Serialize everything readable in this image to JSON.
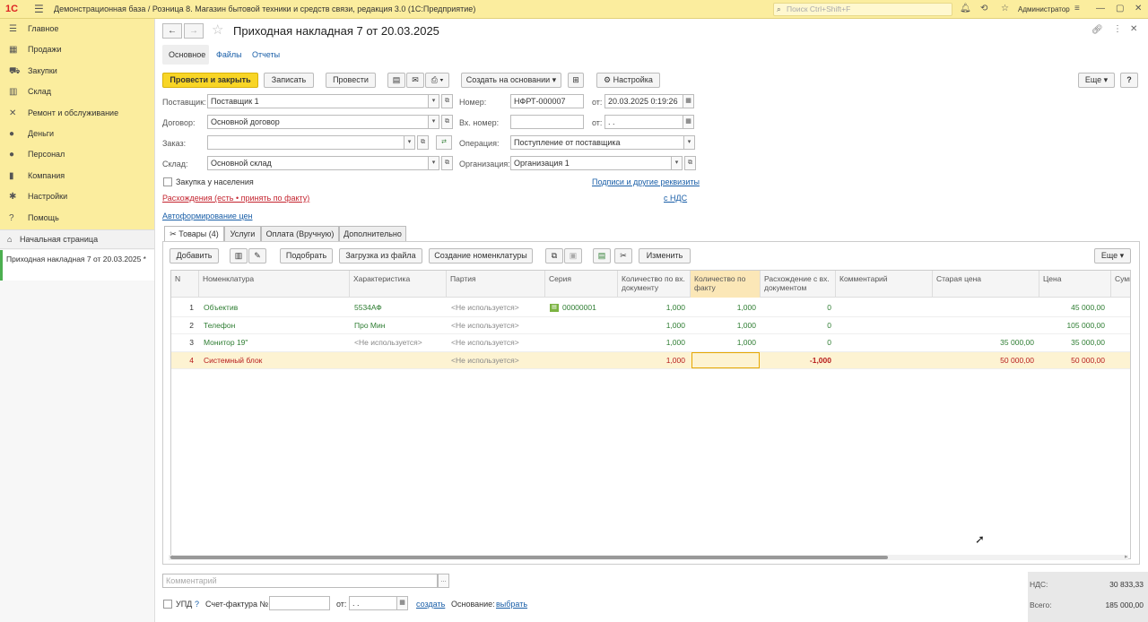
{
  "app": {
    "logo": "1С",
    "title": "Демонстрационная база / Розница 8. Магазин бытовой техники и средств связи, редакция 3.0  (1С:Предприятие)",
    "search_placeholder": "Поиск Ctrl+Shift+F",
    "user": "Администратор"
  },
  "sidebar": {
    "items": [
      {
        "label": "Главное",
        "icon": "menu-icon"
      },
      {
        "label": "Продажи",
        "icon": "cash-register-icon"
      },
      {
        "label": "Закупки",
        "icon": "truck-icon"
      },
      {
        "label": "Склад",
        "icon": "warehouse-icon"
      },
      {
        "label": "Ремонт и обслуживание",
        "icon": "wrench-icon"
      },
      {
        "label": "Деньги",
        "icon": "coin-icon"
      },
      {
        "label": "Персонал",
        "icon": "person-icon"
      },
      {
        "label": "Компания",
        "icon": "building-icon"
      },
      {
        "label": "Настройки",
        "icon": "gear-icon"
      },
      {
        "label": "Помощь",
        "icon": "help-icon"
      }
    ],
    "home": "Начальная страница",
    "open_doc": "Приходная накладная 7 от 20.03.2025 *"
  },
  "doc": {
    "title": "Приходная накладная 7 от 20.03.2025",
    "tabs": [
      "Основное",
      "Файлы",
      "Отчеты"
    ],
    "toolbar": {
      "post_close": "Провести и закрыть",
      "save": "Записать",
      "post": "Провести",
      "create_based": "Создать на основании",
      "settings": "Настройка",
      "more": "Еще"
    },
    "fields": {
      "supplier_label": "Поставщик:",
      "supplier": "Поставщик 1",
      "contract_label": "Договор:",
      "contract": "Основной договор",
      "order_label": "Заказ:",
      "order": "",
      "warehouse_label": "Склад:",
      "warehouse": "Основной склад",
      "number_label": "Номер:",
      "number": "НФРТ-000007",
      "from_label": "от:",
      "date": "20.03.2025  0:19:26",
      "in_number_label": "Вх. номер:",
      "in_number": "",
      "in_date": " .  .",
      "operation_label": "Операция:",
      "operation": "Поступление от поставщика",
      "org_label": "Организация:",
      "org": "Организация 1",
      "population_label": "Закупка у населения",
      "discrepancy_link": "Расхождения (есть • принять по факту)",
      "auto_prices_link": "Автоформирование цен",
      "signatures_link": "Подписи и другие реквизиты",
      "vat_link": "с НДС"
    },
    "inner_tabs": [
      "Товары (4)",
      "Услуги",
      "Оплата (Вручную)",
      "Дополнительно"
    ],
    "grid_toolbar": {
      "add": "Добавить",
      "pick": "Подобрать",
      "load": "Загрузка из файла",
      "create_nom": "Создание номенклатуры",
      "change": "Изменить",
      "more": "Еще"
    },
    "columns": [
      "N",
      "Номенклатура",
      "Характеристика",
      "Партия",
      "Серия",
      "Количество по вх. документу",
      "Количество по факту",
      "Расхождение с вх. документом",
      "Комментарий",
      "Старая цена",
      "Цена",
      "Сумма"
    ],
    "rows": [
      {
        "n": "1",
        "nom": "Объектив",
        "char": "5534АФ",
        "batch": "<Не используется>",
        "series": "00000001",
        "qty_doc": "1,000",
        "qty_fact": "1,000",
        "diff": "0",
        "comment": "",
        "old_price": "",
        "price": "45 000,00"
      },
      {
        "n": "2",
        "nom": "Телефон",
        "char": "Про Мин",
        "batch": "<Не используется>",
        "series": "",
        "qty_doc": "1,000",
        "qty_fact": "1,000",
        "diff": "0",
        "comment": "",
        "old_price": "",
        "price": "105 000,00"
      },
      {
        "n": "3",
        "nom": "Монитор 19\"",
        "char": "<Не используется>",
        "batch": "<Не используется>",
        "series": "",
        "qty_doc": "1,000",
        "qty_fact": "1,000",
        "diff": "0",
        "comment": "",
        "old_price": "35 000,00",
        "price": "35 000,00"
      },
      {
        "n": "4",
        "nom": "Системный блок",
        "char": "",
        "batch": "<Не используется>",
        "series": "",
        "qty_doc": "1,000",
        "qty_fact": "",
        "diff": "-1,000",
        "comment": "",
        "old_price": "50 000,00",
        "price": "50 000,00"
      }
    ],
    "footer": {
      "comment_placeholder": "Комментарий",
      "upd_label": "УПД",
      "upd_help": "?",
      "invoice_label": "Счет-фактура №:",
      "from_label": "от:",
      "invoice_date": " .  .",
      "create_link": "создать",
      "basis_label": "Основание:",
      "basis_link": "выбрать",
      "vat_label": "НДС:",
      "vat_value": "30 833,33",
      "total_label": "Всего:",
      "total_value": "185 000,00"
    }
  }
}
